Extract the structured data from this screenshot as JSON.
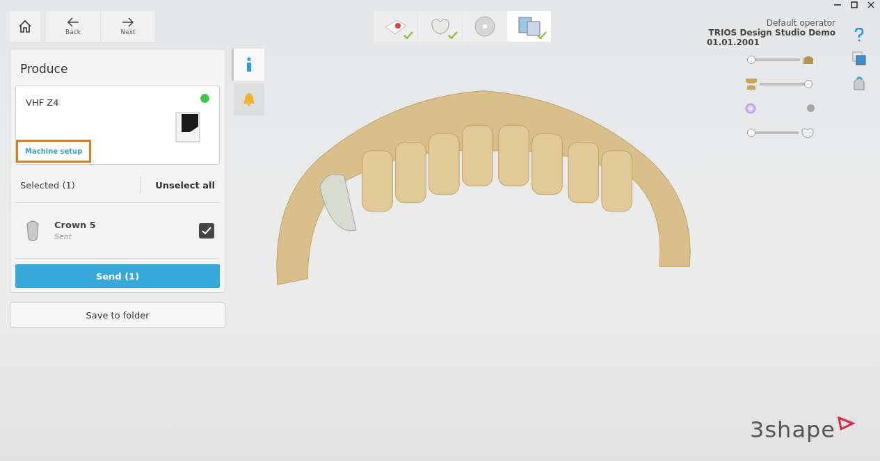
{
  "toolbar": {
    "buttons": [
      {
        "kind": "home"
      },
      {
        "kind": "back",
        "label": "Back"
      },
      {
        "kind": "next",
        "label": "Next"
      }
    ]
  },
  "workflow": [
    {
      "kind": "order",
      "done": true,
      "selected": false
    },
    {
      "kind": "crown",
      "done": true,
      "selected": false
    },
    {
      "kind": "disc",
      "done": false,
      "selected": false
    },
    {
      "kind": "machine",
      "done": true,
      "selected": true
    }
  ],
  "produce": {
    "title": "Produce",
    "machine": {
      "name": "VHF Z4",
      "online": true,
      "setup_link": "Machine setup",
      "highlighted": true
    },
    "selected_label": "Selected (1)",
    "unselect_label": "Unselect all",
    "items": [
      {
        "name": "Crown 5",
        "status": "Sent",
        "checked": true
      }
    ],
    "send_button": "Send (1)"
  },
  "save_button": "Save to folder",
  "side_buttons": [
    {
      "kind": "info",
      "selected": true
    },
    {
      "kind": "alert",
      "selected": false
    }
  ],
  "operator": {
    "label": "Default operator",
    "name": "TRIOS Design Studio Demo",
    "date": "01.01.2001"
  },
  "view_controls": [
    {
      "kind": "slider",
      "level": 0
    },
    {
      "kind": "slider",
      "level": 1
    },
    {
      "kind": "toggle",
      "on": false
    },
    {
      "kind": "slider",
      "level": 0
    }
  ],
  "brand": "3shape"
}
